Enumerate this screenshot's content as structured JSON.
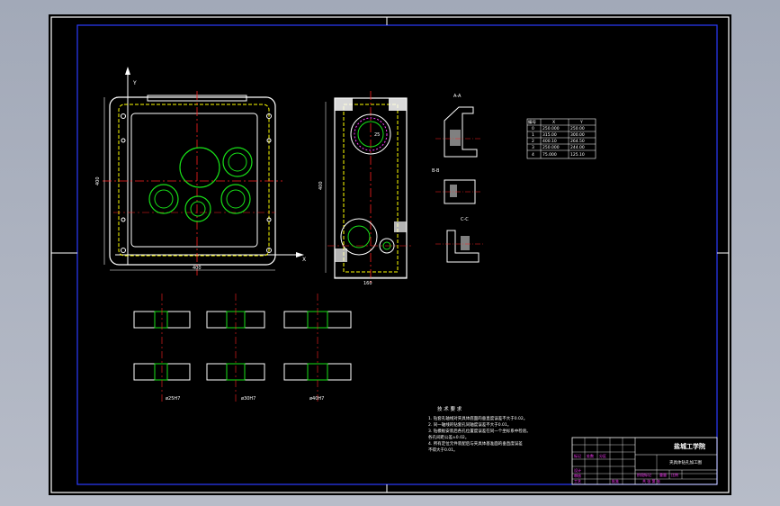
{
  "drawing": {
    "axis_labels": {
      "y": "Y",
      "x": "X"
    },
    "dimensions": {
      "width_top": "400",
      "height_left": "400",
      "height_mid": "400",
      "mid_bottom": "160"
    },
    "section_labels": {
      "aa": "A-A",
      "bb": "B-B",
      "cc": "C-C"
    },
    "center_circle_label": "25",
    "sections_bottom": {
      "dim1": "ø25H7",
      "dim2": "ø30H7",
      "dim3": "ø40H7"
    }
  },
  "coord_table": {
    "headers": [
      "编号",
      "X",
      "Y"
    ],
    "rows": [
      [
        "0",
        "250.000",
        "250.00"
      ],
      [
        "1",
        "315.00",
        "300.00"
      ],
      [
        "2",
        "400.10",
        "264.50"
      ],
      [
        "3",
        "250.000",
        "244.00"
      ],
      [
        "4",
        "75.000",
        "125.10"
      ]
    ]
  },
  "notes": {
    "title": "技 术 要 求",
    "lines": [
      "1. 钻套孔轴线对夹具体底面的垂直度误差不大于0.02。",
      "2. 同一轴线的钻套孔同轴度误差不大于0.01。",
      "3. 钻模板安装后各孔位置度误差在同一个坐标系中检验。",
      "   各孔间距公差±0.02。",
      "4. 所有定位元件装配后与夹具体基准面的垂直度误差",
      "   不得大于0.01。"
    ]
  },
  "title_block": {
    "school": "盐城工学院",
    "drawing_name": "夹具体钻孔加工图",
    "cells": [
      "标记",
      "处数",
      "分区",
      "设计",
      "审核",
      "工艺",
      "批准",
      "阶段标记",
      "重量",
      "比例"
    ],
    "footer": "共 张 第 张"
  }
}
